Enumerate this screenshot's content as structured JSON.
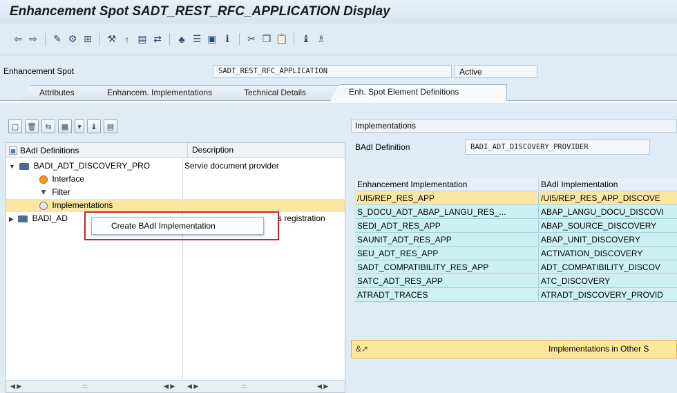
{
  "window": {
    "title": "Enhancement Spot SADT_REST_RFC_APPLICATION Display"
  },
  "toolbar": {
    "icons": [
      "back-icon",
      "forward-icon",
      "toggle-display-change-icon",
      "other-object-icon",
      "check-icon",
      "activate-icon",
      "where-used-icon",
      "object-list-icon",
      "navigation-icon",
      "hierarchy-icon",
      "display-object-list-icon",
      "frame-icon",
      "info-icon",
      "cut-icon",
      "copy-icon",
      "paste-icon",
      "find-icon",
      "find-next-icon"
    ]
  },
  "spot": {
    "label": "Enhancement Spot",
    "value": "SADT_REST_RFC_APPLICATION",
    "status": "Active"
  },
  "tabs": [
    {
      "label": "Attributes"
    },
    {
      "label": "Enhancem. Implementations"
    },
    {
      "label": "Technical Details"
    },
    {
      "label": "Enh. Spot Element Definitions"
    }
  ],
  "tree": {
    "col_name": "BAdI Definitions",
    "col_desc": "Description",
    "rows": [
      {
        "name": "BADI_ADT_DISCOVERY_PRO",
        "desc": "Servie document provider"
      },
      {
        "name": "Interface",
        "desc": ""
      },
      {
        "name": "Filter",
        "desc": ""
      },
      {
        "name": "Implementations",
        "desc": ""
      },
      {
        "name": "BADI_AD",
        "desc": "s registration"
      }
    ],
    "footer_dots": ":::"
  },
  "context_menu": {
    "item": "Create BAdI Implementation"
  },
  "right": {
    "panel_title": "Implementations",
    "badi_def_label": "BAdI Definition",
    "badi_def_value": "BADI_ADT_DISCOVERY_PROVIDER",
    "grid": {
      "col_impl": "Enhancement Implementation",
      "col_badi": "BAdI Implementation",
      "rows": [
        {
          "impl": "/UI5/REP_RES_APP",
          "badi": "/UI5/REP_RES_APP_DISCOVE"
        },
        {
          "impl": "S_DOCU_ADT_ABAP_LANGU_RES_...",
          "badi": "ABAP_LANGU_DOCU_DISCOVI"
        },
        {
          "impl": "SEDI_ADT_RES_APP",
          "badi": "ABAP_SOURCE_DISCOVERY"
        },
        {
          "impl": "SAUNIT_ADT_RES_APP",
          "badi": "ABAP_UNIT_DISCOVERY"
        },
        {
          "impl": "SEU_ADT_RES_APP",
          "badi": "ACTIVATION_DISCOVERY"
        },
        {
          "impl": "SADT_COMPATIBILITY_RES_APP",
          "badi": "ADT_COMPATIBILITY_DISCOV"
        },
        {
          "impl": "SATC_ADT_RES_APP",
          "badi": "ATC_DISCOVERY"
        },
        {
          "impl": "ATRADT_TRACES",
          "badi": "ATRADT_DISCOVERY_PROVID"
        }
      ]
    },
    "other_impl": "Implementations in Other S"
  },
  "colors": {
    "selected_row": "#fce7a2",
    "grid_row": "#cdf0f5",
    "highlight_box": "#c0282d",
    "background": "#dfebf5"
  }
}
